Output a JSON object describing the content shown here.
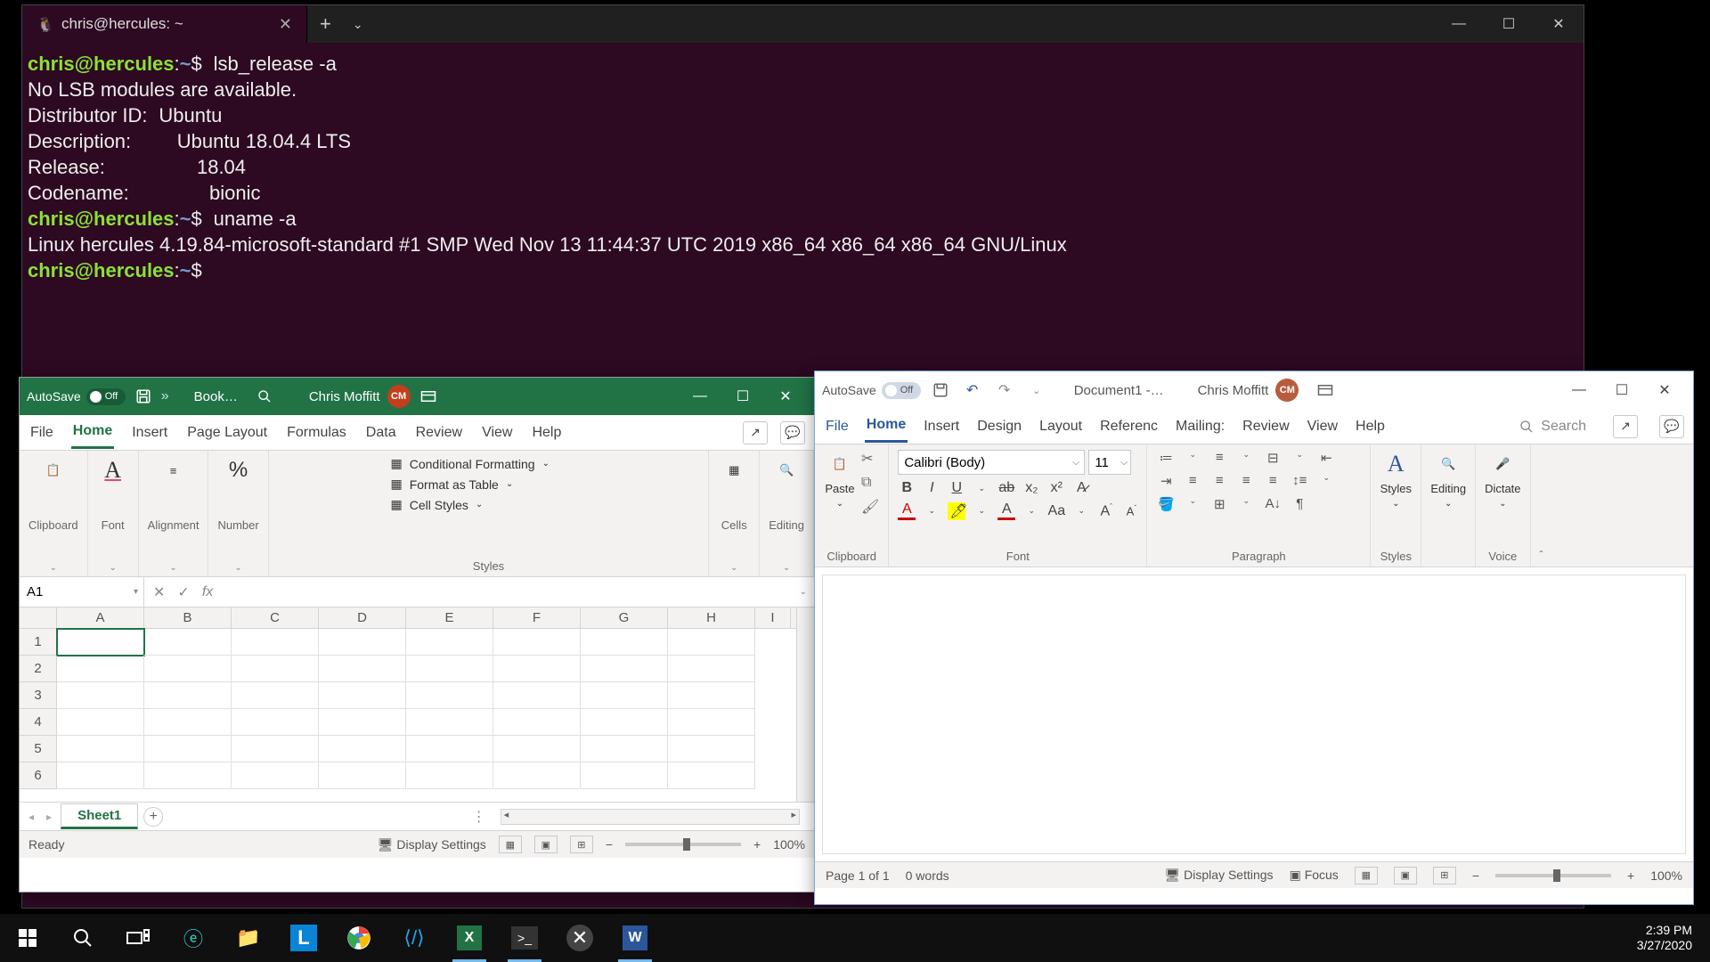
{
  "terminal": {
    "tab_title": "chris@hercules: ~",
    "prompt_user": "chris@hercules",
    "prompt_sep": ":",
    "prompt_path": "~",
    "prompt_sym": "$",
    "cmd1": "lsb_release -a",
    "out_nolsb": "No LSB modules are available.",
    "out_distid_l": "Distributor ID:",
    "out_distid_v": "Ubuntu",
    "out_desc_l": "Description:",
    "out_desc_v": "Ubuntu 18.04.4 LTS",
    "out_rel_l": "Release:",
    "out_rel_v": "18.04",
    "out_code_l": "Codename:",
    "out_code_v": "bionic",
    "cmd2": "uname -a",
    "out_uname": "Linux hercules 4.19.84-microsoft-standard #1 SMP Wed Nov 13 11:44:37 UTC 2019 x86_64 x86_64 x86_64 GNU/Linux"
  },
  "excel": {
    "autosave_label": "AutoSave",
    "autosave_state": "Off",
    "doc_title": "Book…",
    "user_name": "Chris Moffitt",
    "user_initials": "CM",
    "tabs": {
      "file": "File",
      "home": "Home",
      "insert": "Insert",
      "page": "Page Layout",
      "formulas": "Formulas",
      "data": "Data",
      "review": "Review",
      "view": "View",
      "help": "Help"
    },
    "groups": {
      "clipboard": "Clipboard",
      "font": "Font",
      "alignment": "Alignment",
      "number": "Number",
      "styles": "Styles",
      "cells": "Cells",
      "editing": "Editing"
    },
    "styles_items": {
      "cond": "Conditional Formatting",
      "table": "Format as Table",
      "cell": "Cell Styles"
    },
    "name_box": "A1",
    "columns": [
      "A",
      "B",
      "C",
      "D",
      "E",
      "F",
      "G",
      "H",
      "I"
    ],
    "rows": [
      "1",
      "2",
      "3",
      "4",
      "5",
      "6"
    ],
    "sheet_tab": "Sheet1",
    "status_ready": "Ready",
    "display_settings": "Display Settings",
    "zoom": "100%"
  },
  "word": {
    "autosave_label": "AutoSave",
    "autosave_state": "Off",
    "doc_title": "Document1 -…",
    "user_name": "Chris Moffitt",
    "user_initials": "CM",
    "tabs": {
      "file": "File",
      "home": "Home",
      "insert": "Insert",
      "design": "Design",
      "layout": "Layout",
      "references": "Referenc",
      "mailings": "Mailing:",
      "review": "Review",
      "view": "View",
      "help": "Help"
    },
    "search": "Search",
    "font_name": "Calibri (Body)",
    "font_size": "11",
    "groups": {
      "clipboard": "Clipboard",
      "font": "Font",
      "paragraph": "Paragraph",
      "styles": "Styles",
      "editing": "Editing",
      "dictate": "Dictate",
      "voice": "Voice"
    },
    "paste": "Paste",
    "styles": "Styles",
    "editing": "Editing",
    "dictate": "Dictate",
    "status_page": "Page 1 of 1",
    "status_words": "0 words",
    "display_settings": "Display Settings",
    "focus": "Focus",
    "zoom": "100%"
  },
  "taskbar": {
    "time": "2:39 PM",
    "date": "3/27/2020"
  }
}
